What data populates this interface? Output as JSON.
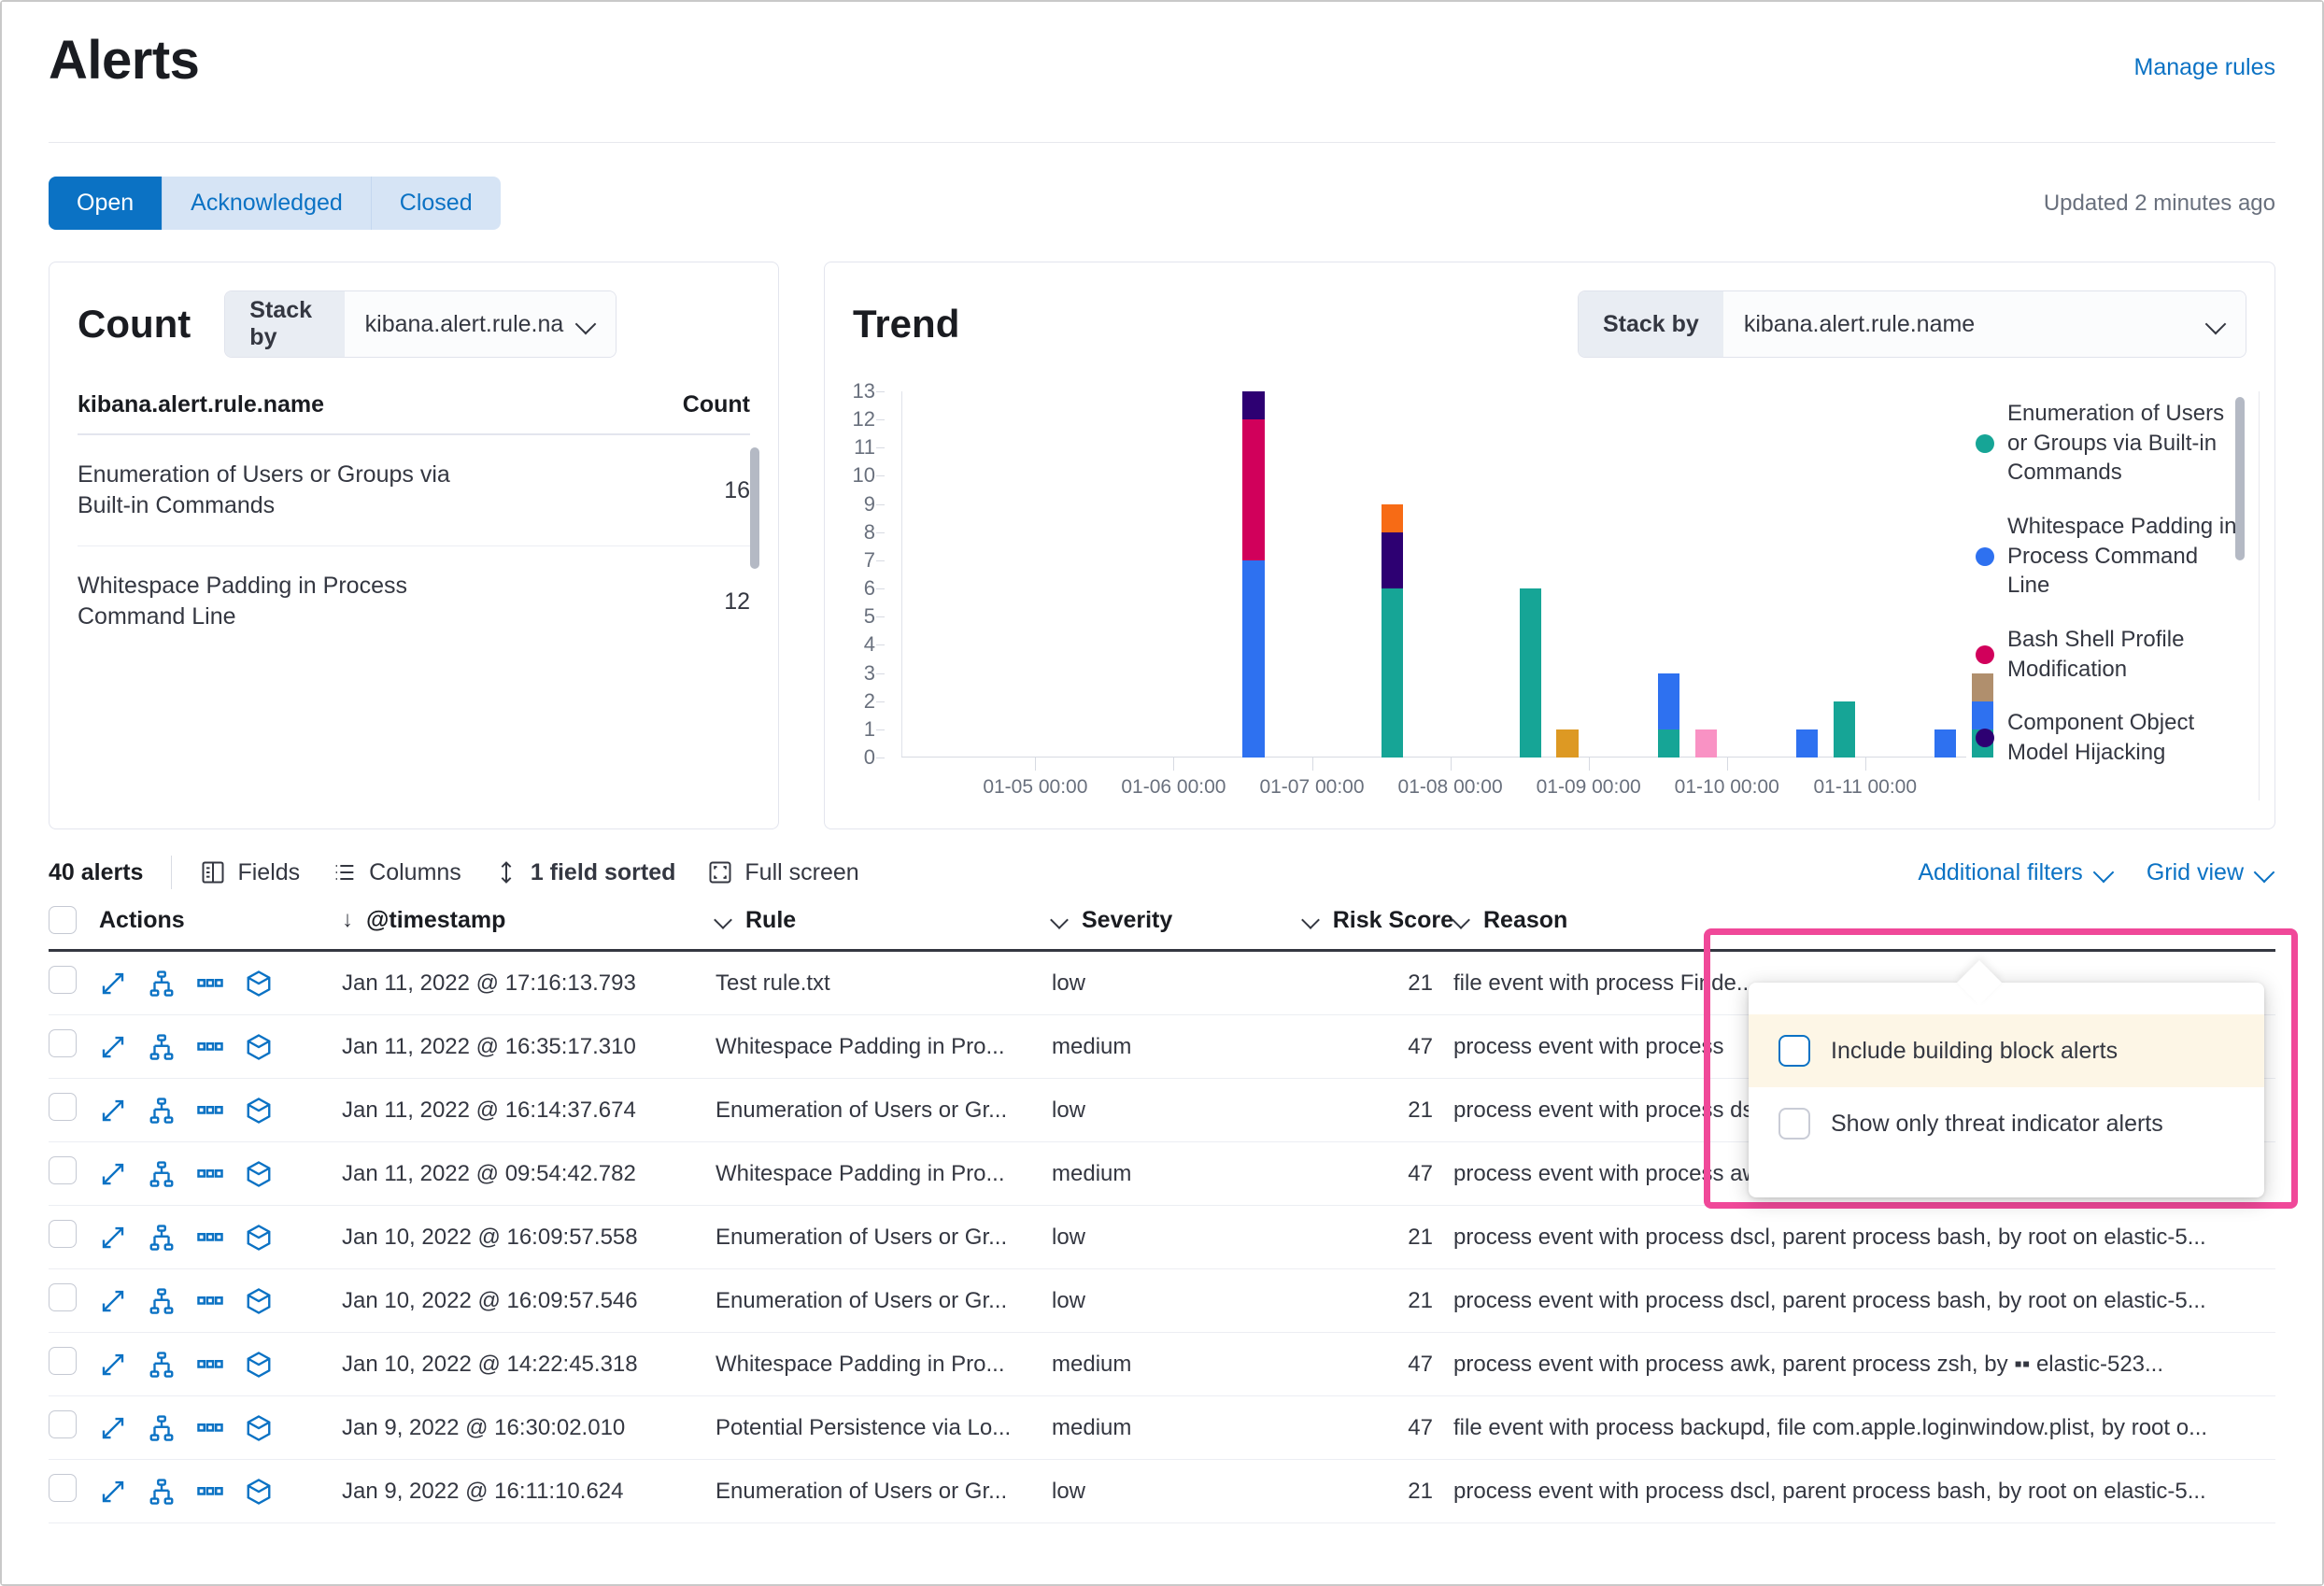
{
  "header": {
    "title": "Alerts",
    "manage_rules_label": "Manage rules"
  },
  "status_tabs": {
    "items": [
      {
        "label": "Open",
        "active": true
      },
      {
        "label": "Acknowledged",
        "active": false
      },
      {
        "label": "Closed",
        "active": false
      }
    ],
    "updated_text": "Updated 2 minutes ago"
  },
  "count_panel": {
    "title": "Count",
    "stack_by_label": "Stack by",
    "stack_by_value": "kibana.alert.rule.na",
    "table": {
      "columns": [
        "kibana.alert.rule.name",
        "Count"
      ],
      "rows": [
        {
          "name": "Enumeration of Users or Groups via Built-in Commands",
          "count": "16"
        },
        {
          "name": "Whitespace Padding in Process Command Line",
          "count": "12"
        }
      ]
    }
  },
  "trend_panel": {
    "title": "Trend",
    "stack_by_label": "Stack by",
    "stack_by_value": "kibana.alert.rule.name"
  },
  "chart_data": {
    "type": "bar",
    "title": "Trend",
    "stacked": true,
    "xlabel": "",
    "ylabel": "",
    "ylim": [
      0,
      13
    ],
    "yticks": [
      0,
      1,
      2,
      3,
      4,
      5,
      6,
      7,
      8,
      9,
      10,
      11,
      12,
      13
    ],
    "grid": false,
    "legend_position": "right",
    "x_tick_labels": [
      "01-05 00:00",
      "01-06 00:00",
      "01-07 00:00",
      "01-08 00:00",
      "01-09 00:00",
      "01-10 00:00",
      "01-11 00:00"
    ],
    "legend": [
      {
        "label": "Enumeration of Users or Groups via Built-in Commands",
        "color": "#16a596"
      },
      {
        "label": "Whitespace Padding in Process Command Line",
        "color": "#2e71f0"
      },
      {
        "label": "Bash Shell Profile Modification",
        "color": "#d1005b"
      },
      {
        "label": "Component Object Model Hijacking",
        "color": "#2d0072"
      }
    ],
    "extra_colors": {
      "orange": "#f76b15",
      "amber": "#dd9923",
      "pink": "#f992c4",
      "tan": "#b08f6d"
    },
    "bars": [
      {
        "x": "01-07 00:00",
        "offset_pct": 32.0,
        "segments": [
          {
            "series": "Whitespace Padding in Process Command Line",
            "value": 7,
            "color": "#2e71f0"
          },
          {
            "series": "Bash Shell Profile Modification",
            "value": 5,
            "color": "#d1005b"
          },
          {
            "series": "Component Object Model Hijacking",
            "value": 1,
            "color": "#2d0072"
          }
        ],
        "total": 13
      },
      {
        "x": "01-08 00:00",
        "offset_pct": 45.0,
        "segments": [
          {
            "series": "Enumeration of Users or Groups via Built-in Commands",
            "value": 6,
            "color": "#16a596"
          },
          {
            "series": "Component Object Model Hijacking",
            "value": 2,
            "color": "#2d0072"
          },
          {
            "series": "Other (orange)",
            "value": 1,
            "color": "#f76b15"
          }
        ],
        "total": 9
      },
      {
        "x": "01-09 00:00",
        "offset_pct": 58.0,
        "segments": [
          {
            "series": "Enumeration of Users or Groups via Built-in Commands",
            "value": 6,
            "color": "#16a596"
          }
        ],
        "total": 6
      },
      {
        "x": "01-09 00:00b",
        "offset_pct": 61.5,
        "segments": [
          {
            "series": "Other (amber)",
            "value": 1,
            "color": "#dd9923"
          }
        ],
        "total": 1
      },
      {
        "x": "01-10 00:00",
        "offset_pct": 71.0,
        "segments": [
          {
            "series": "Enumeration of Users or Groups via Built-in Commands",
            "value": 1,
            "color": "#16a596"
          },
          {
            "series": "Whitespace Padding in Process Command Line",
            "value": 2,
            "color": "#2e71f0"
          }
        ],
        "total": 3
      },
      {
        "x": "01-10 00:00b",
        "offset_pct": 74.5,
        "segments": [
          {
            "series": "Other (pink)",
            "value": 1,
            "color": "#f992c4"
          }
        ],
        "total": 1
      },
      {
        "x": "01-11 00:00",
        "offset_pct": 84.0,
        "segments": [
          {
            "series": "Whitespace Padding in Process Command Line",
            "value": 1,
            "color": "#2e71f0"
          }
        ],
        "total": 1
      },
      {
        "x": "01-11 00:00b",
        "offset_pct": 87.5,
        "segments": [
          {
            "series": "Enumeration of Users or Groups via Built-in Commands",
            "value": 2,
            "color": "#16a596"
          }
        ],
        "total": 2
      },
      {
        "x": "01-12 00:00",
        "offset_pct": 97.0,
        "segments": [
          {
            "series": "Whitespace Padding in Process Command Line",
            "value": 1,
            "color": "#2e71f0"
          }
        ],
        "total": 1
      },
      {
        "x": "01-12 00:00b",
        "offset_pct": 100.5,
        "segments": [
          {
            "series": "Enumeration of Users or Groups via Built-in Commands",
            "value": 1,
            "color": "#16a596"
          },
          {
            "series": "Whitespace Padding in Process Command Line",
            "value": 1,
            "color": "#2e71f0"
          },
          {
            "series": "Other (tan)",
            "value": 1,
            "color": "#b08f6d"
          }
        ],
        "total": 3
      }
    ]
  },
  "grid_toolbar": {
    "alerts_count": "40 alerts",
    "fields_label": "Fields",
    "columns_label": "Columns",
    "sorted_label": "1 field sorted",
    "fullscreen_label": "Full screen",
    "additional_filters_label": "Additional filters",
    "grid_view_label": "Grid view"
  },
  "additional_filters_popover": {
    "items": [
      {
        "label": "Include building block alerts",
        "checked": false,
        "highlighted": true
      },
      {
        "label": "Show only threat indicator alerts",
        "checked": false,
        "highlighted": false
      }
    ]
  },
  "alerts_table": {
    "columns": [
      "Actions",
      "@timestamp",
      "Rule",
      "Severity",
      "Risk Score",
      "Reason"
    ],
    "rows": [
      {
        "timestamp": "Jan 11, 2022 @ 17:16:13.793",
        "rule": "Test rule.txt",
        "severity": "low",
        "risk_score": "21",
        "reason": "file event with process Finde..."
      },
      {
        "timestamp": "Jan 11, 2022 @ 16:35:17.310",
        "rule": "Whitespace Padding in Pro...",
        "severity": "medium",
        "risk_score": "47",
        "reason": "process event with process"
      },
      {
        "timestamp": "Jan 11, 2022 @ 16:14:37.674",
        "rule": "Enumeration of Users or Gr...",
        "severity": "low",
        "risk_score": "21",
        "reason": "process event with process dsmemberutil, parent process bash, by root on ..."
      },
      {
        "timestamp": "Jan 11, 2022 @ 09:54:42.782",
        "rule": "Whitespace Padding in Pro...",
        "severity": "medium",
        "risk_score": "47",
        "reason": "process event with process awk, parent process zsh, by ▪▪ elastic-523..."
      },
      {
        "timestamp": "Jan 10, 2022 @ 16:09:57.558",
        "rule": "Enumeration of Users or Gr...",
        "severity": "low",
        "risk_score": "21",
        "reason": "process event with process dscl, parent process bash, by root on elastic-5..."
      },
      {
        "timestamp": "Jan 10, 2022 @ 16:09:57.546",
        "rule": "Enumeration of Users or Gr...",
        "severity": "low",
        "risk_score": "21",
        "reason": "process event with process dscl, parent process bash, by root on elastic-5..."
      },
      {
        "timestamp": "Jan 10, 2022 @ 14:22:45.318",
        "rule": "Whitespace Padding in Pro...",
        "severity": "medium",
        "risk_score": "47",
        "reason": "process event with process awk, parent process zsh, by ▪▪ elastic-523..."
      },
      {
        "timestamp": "Jan 9, 2022 @ 16:30:02.010",
        "rule": "Potential Persistence via Lo...",
        "severity": "medium",
        "risk_score": "47",
        "reason": "file event with process backupd, file com.apple.loginwindow.plist, by root o..."
      },
      {
        "timestamp": "Jan 9, 2022 @ 16:11:10.624",
        "rule": "Enumeration of Users or Gr...",
        "severity": "low",
        "risk_score": "21",
        "reason": "process event with process dscl, parent process bash, by root on elastic-5..."
      }
    ]
  },
  "colors": {
    "accent_blue": "#0b72c4",
    "highlight_pink": "#f04899",
    "text_dark": "#343741"
  }
}
